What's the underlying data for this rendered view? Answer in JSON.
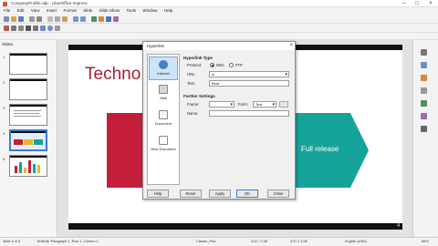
{
  "window": {
    "title": "CompanyProfile.odp - LibreOffice Impress"
  },
  "menu": [
    "File",
    "Edit",
    "View",
    "Insert",
    "Format",
    "Slide",
    "Slide Show",
    "Tools",
    "Window",
    "Help"
  ],
  "slides_pane": {
    "header": "Slides",
    "numbers": [
      "1",
      "2",
      "3",
      "4",
      "5"
    ]
  },
  "slide": {
    "title": "Techno",
    "teal_text": "Full release",
    "page_number": "4"
  },
  "dialog": {
    "title": "Hyperlink",
    "categories": [
      "Internet",
      "Mail",
      "Document",
      "New Document"
    ],
    "hyperlink_type_header": "Hyperlink Type",
    "type_label": "Protocol",
    "opt_web": "Web",
    "opt_ftp": "FTP",
    "url_label": "URL:",
    "url_value": "w",
    "text_label": "Text:",
    "text_value": "Beta",
    "further_header": "Further Settings",
    "frame_label": "Frame:",
    "form_label": "Form:",
    "form_value": "Text",
    "name_label": "Name:",
    "buttons": {
      "help": "Help",
      "reset": "Reset",
      "apply": "Apply",
      "ok": "OK",
      "close": "Close"
    }
  },
  "status": {
    "slide_info": "Slide 4 of 5",
    "edit_info": "TextEdit: Paragraph 1, Row 1, Column 1",
    "layout": "Classic_Red",
    "pos": "4.02 / 2.08",
    "size": "4.07 x 3.06",
    "lang": "English (USA)",
    "zoom": "88%"
  },
  "colors": {
    "accent_red": "#c41e3a",
    "accent_teal": "#16a39a",
    "title_red": "#a41d35"
  }
}
